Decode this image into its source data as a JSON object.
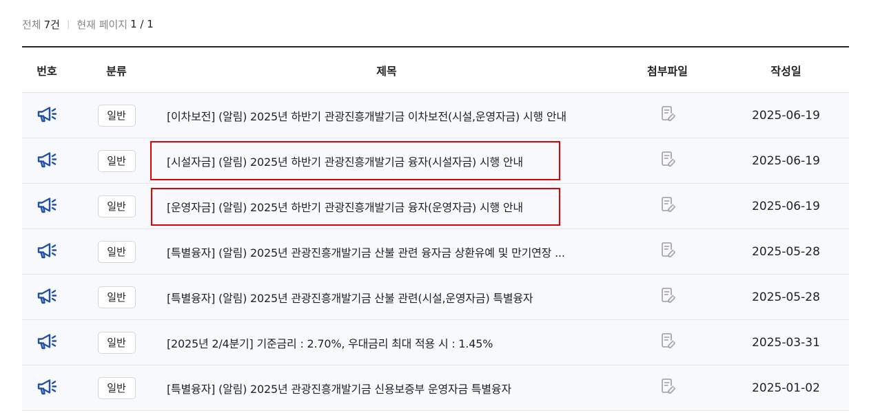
{
  "summary": {
    "total_label": "전체",
    "total_count": "7건",
    "page_label": "현재 페이지",
    "page_value": "1 / 1"
  },
  "table": {
    "headers": {
      "no": "번호",
      "category": "분류",
      "title": "제목",
      "attachment": "첨부파일",
      "date": "작성일"
    },
    "rows": [
      {
        "category": "일반",
        "title": "[이차보전] (알림) 2025년 하반기 관광진흥개발기금 이차보전(시설,운영자금) 시행 안내",
        "date": "2025-06-19"
      },
      {
        "category": "일반",
        "title": "[시설자금] (알림) 2025년 하반기 관광진흥개발기금 융자(시설자금) 시행 안내",
        "date": "2025-06-19",
        "highlighted": true
      },
      {
        "category": "일반",
        "title": "[운영자금] (알림) 2025년 하반기 관광진흥개발기금 융자(운영자금) 시행 안내",
        "date": "2025-06-19",
        "highlighted": true
      },
      {
        "category": "일반",
        "title": "[특별융자] (알림) 2025년 관광진흥개발기금 산불 관련 융자금 상환유예 및 만기연장 ...",
        "date": "2025-05-28"
      },
      {
        "category": "일반",
        "title": "[특별융자] (알림) 2025년 관광진흥개발기금 산불 관련(시설,운영자금) 특별융자",
        "date": "2025-05-28"
      },
      {
        "category": "일반",
        "title": "[2025년 2/4분기] 기준금리 : 2.70%, 우대금리 최대 적용 시 : 1.45%",
        "date": "2025-03-31"
      },
      {
        "category": "일반",
        "title": "[특별융자] (알림) 2025년 관광진흥개발기금 신용보증부 운영자금 특별융자",
        "date": "2025-01-02"
      }
    ]
  },
  "icons": {
    "notice": "megaphone-icon",
    "attachment": "attachment-file-icon"
  },
  "colors": {
    "notice_icon": "#1f4fa8",
    "file_icon": "#a8a8a8",
    "highlight_border": "#e00000",
    "row_background": "#f7f9fc"
  }
}
